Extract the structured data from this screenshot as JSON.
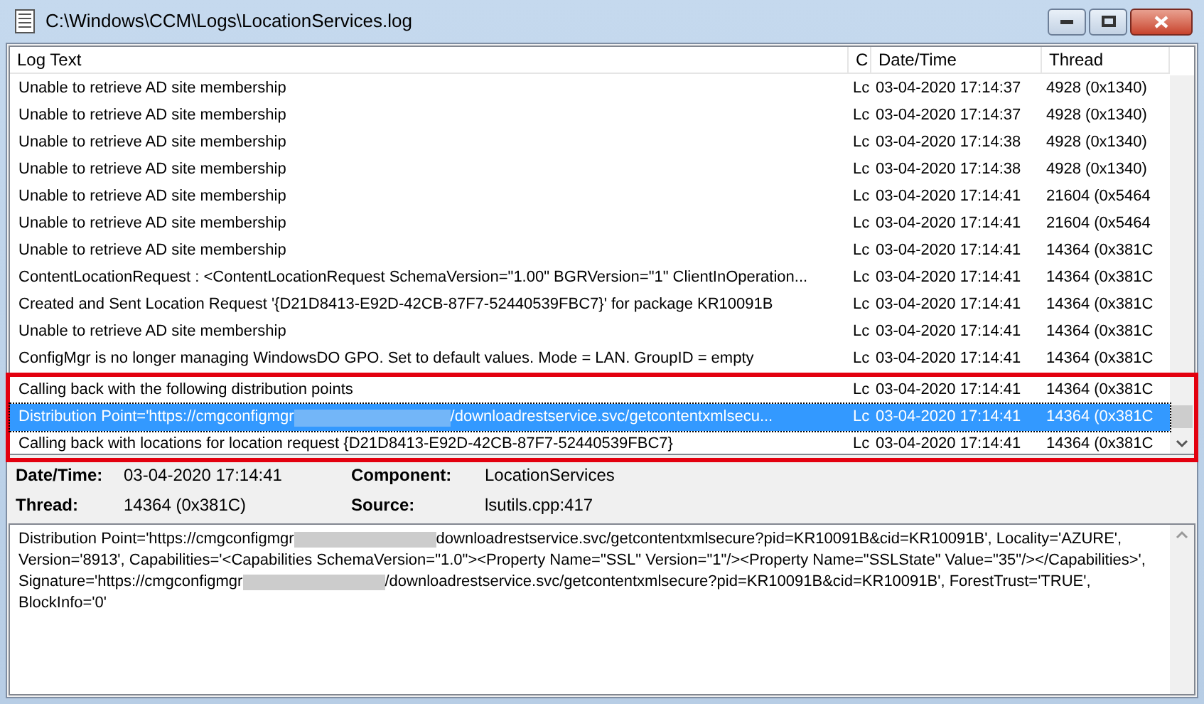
{
  "window": {
    "title": "C:\\Windows\\CCM\\Logs\\LocationServices.log"
  },
  "columns": [
    "Log Text",
    "C",
    "Date/Time",
    "Thread"
  ],
  "rows": [
    {
      "parts": [
        {
          "kind": "text",
          "text": "Unable to retrieve AD site membership"
        }
      ],
      "component": "Lc",
      "datetime": "03-04-2020 17:14:37",
      "thread": "4928 (0x1340)",
      "selected": false,
      "highlighted": false
    },
    {
      "parts": [
        {
          "kind": "text",
          "text": "Unable to retrieve AD site membership"
        }
      ],
      "component": "Lc",
      "datetime": "03-04-2020 17:14:37",
      "thread": "4928 (0x1340)",
      "selected": false,
      "highlighted": false
    },
    {
      "parts": [
        {
          "kind": "text",
          "text": "Unable to retrieve AD site membership"
        }
      ],
      "component": "Lc",
      "datetime": "03-04-2020 17:14:38",
      "thread": "4928 (0x1340)",
      "selected": false,
      "highlighted": false
    },
    {
      "parts": [
        {
          "kind": "text",
          "text": "Unable to retrieve AD site membership"
        }
      ],
      "component": "Lc",
      "datetime": "03-04-2020 17:14:38",
      "thread": "4928 (0x1340)",
      "selected": false,
      "highlighted": false
    },
    {
      "parts": [
        {
          "kind": "text",
          "text": "Unable to retrieve AD site membership"
        }
      ],
      "component": "Lc",
      "datetime": "03-04-2020 17:14:41",
      "thread": "21604 (0x5464",
      "selected": false,
      "highlighted": false
    },
    {
      "parts": [
        {
          "kind": "text",
          "text": "Unable to retrieve AD site membership"
        }
      ],
      "component": "Lc",
      "datetime": "03-04-2020 17:14:41",
      "thread": "21604 (0x5464",
      "selected": false,
      "highlighted": false
    },
    {
      "parts": [
        {
          "kind": "text",
          "text": "Unable to retrieve AD site membership"
        }
      ],
      "component": "Lc",
      "datetime": "03-04-2020 17:14:41",
      "thread": "14364 (0x381C",
      "selected": false,
      "highlighted": false
    },
    {
      "parts": [
        {
          "kind": "text",
          "text": "ContentLocationRequest : <ContentLocationRequest SchemaVersion=\"1.00\" BGRVersion=\"1\" ClientInOperation..."
        }
      ],
      "component": "Lc",
      "datetime": "03-04-2020 17:14:41",
      "thread": "14364 (0x381C",
      "selected": false,
      "highlighted": false
    },
    {
      "parts": [
        {
          "kind": "text",
          "text": "Created and Sent Location Request '{D21D8413-E92D-42CB-87F7-52440539FBC7}' for package KR10091B"
        }
      ],
      "component": "Lc",
      "datetime": "03-04-2020 17:14:41",
      "thread": "14364 (0x381C",
      "selected": false,
      "highlighted": false
    },
    {
      "parts": [
        {
          "kind": "text",
          "text": "Unable to retrieve AD site membership"
        }
      ],
      "component": "Lc",
      "datetime": "03-04-2020 17:14:41",
      "thread": "14364 (0x381C",
      "selected": false,
      "highlighted": false
    },
    {
      "parts": [
        {
          "kind": "text",
          "text": "ConfigMgr is no longer managing WindowsDO GPO.  Set to default values. Mode = LAN. GroupID = empty"
        }
      ],
      "component": "Lc",
      "datetime": "03-04-2020 17:14:41",
      "thread": "14364 (0x381C",
      "selected": false,
      "highlighted": false
    },
    {
      "parts": [
        {
          "kind": "text",
          "text": "Calling back with the following distribution points"
        }
      ],
      "component": "Lc",
      "datetime": "03-04-2020 17:14:41",
      "thread": "14364 (0x381C",
      "selected": false,
      "highlighted": true
    },
    {
      "parts": [
        {
          "kind": "text",
          "text": "Distribution Point='https://cmgconfigmgr"
        },
        {
          "kind": "redaction"
        },
        {
          "kind": "text",
          "text": "/downloadrestservice.svc/getcontentxmlsecu..."
        }
      ],
      "component": "Lc",
      "datetime": "03-04-2020 17:14:41",
      "thread": "14364 (0x381C",
      "selected": true,
      "highlighted": true
    },
    {
      "parts": [
        {
          "kind": "text",
          "text": "Calling back with locations for location request {D21D8413-E92D-42CB-87F7-52440539FBC7}"
        }
      ],
      "component": "Lc",
      "datetime": "03-04-2020 17:14:41",
      "thread": "14364 (0x381C",
      "selected": false,
      "highlighted": true
    }
  ],
  "details": {
    "datetime_label": "Date/Time:",
    "datetime": "03-04-2020 17:14:41",
    "component_label": "Component:",
    "component": "LocationServices",
    "thread_label": "Thread:",
    "thread": "14364 (0x381C)",
    "source_label": "Source:",
    "source": "lsutils.cpp:417"
  },
  "message": [
    [
      {
        "kind": "text",
        "text": "Distribution Point='https://cmgconfigmgr"
      },
      {
        "kind": "redaction"
      },
      {
        "kind": "text",
        "text": "downloadrestservice.svc/getcontentxmlsecure?pid=KR10091B&cid=KR10091B', Locality='AZURE',"
      }
    ],
    [
      {
        "kind": "text",
        "text": "Version='8913', Capabilities='<Capabilities SchemaVersion=\"1.0\"><Property Name=\"SSL\" Version=\"1\"/><Property Name=\"SSLState\" Value=\"35\"/></Capabilities>',"
      }
    ],
    [
      {
        "kind": "text",
        "text": "Signature='https://cmgconfigmgr"
      },
      {
        "kind": "redaction"
      },
      {
        "kind": "text",
        "text": "/downloadrestservice.svc/getcontentxmlsecure?pid=KR10091B&cid=KR10091B', ForestTrust='TRUE',"
      }
    ],
    [
      {
        "kind": "text",
        "text": "BlockInfo='0'"
      }
    ]
  ]
}
